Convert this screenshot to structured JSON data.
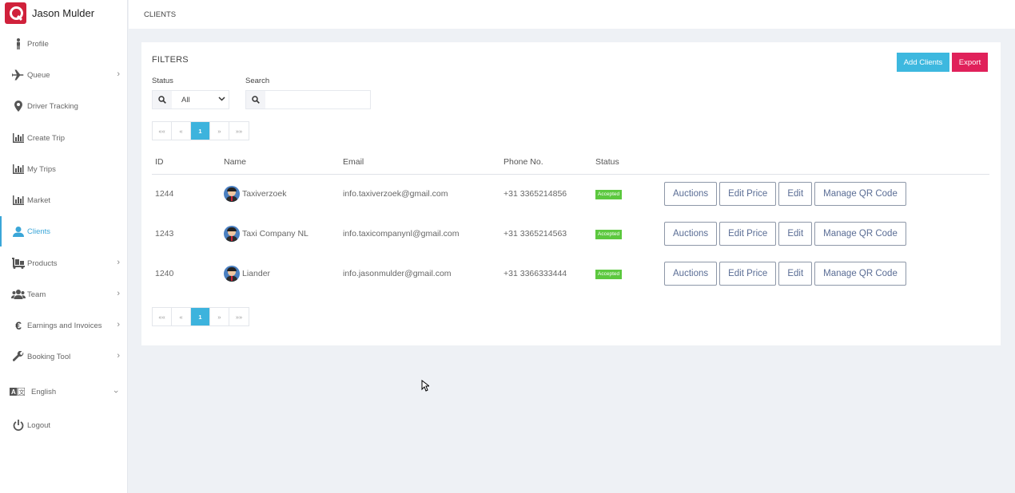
{
  "brand": {
    "name": "Jason Mulder",
    "logo": "q-logo"
  },
  "sidebar": {
    "items": [
      {
        "label": "Profile",
        "icon": "person-icon",
        "chevron": false,
        "active": false
      },
      {
        "label": "Queue",
        "icon": "plane-icon",
        "chevron": true,
        "active": false
      },
      {
        "label": "Driver Tracking",
        "icon": "map-pin-icon",
        "chevron": false,
        "active": false
      },
      {
        "label": "Create Trip",
        "icon": "bar-chart-icon",
        "chevron": false,
        "active": false
      },
      {
        "label": "My Trips",
        "icon": "bar-chart-icon",
        "chevron": false,
        "active": false
      },
      {
        "label": "Market",
        "icon": "bar-chart-icon",
        "chevron": false,
        "active": false
      },
      {
        "label": "Clients",
        "icon": "user-icon",
        "chevron": false,
        "active": true
      },
      {
        "label": "Products",
        "icon": "dolly-icon",
        "chevron": true,
        "active": false
      },
      {
        "label": "Team",
        "icon": "users-icon",
        "chevron": true,
        "active": false
      },
      {
        "label": "Earnings and Invoices",
        "icon": "euro-icon",
        "chevron": true,
        "active": false
      },
      {
        "label": "Booking Tool",
        "icon": "wrench-icon",
        "chevron": true,
        "active": false
      }
    ],
    "language": {
      "label": "English",
      "icon": "language-icon"
    },
    "logout": {
      "label": "Logout",
      "icon": "power-icon"
    }
  },
  "breadcrumb": "CLIENTS",
  "filters": {
    "title": "FILTERS",
    "status_label": "Status",
    "status_value": "All",
    "search_label": "Search",
    "search_value": ""
  },
  "buttons": {
    "add": "Add Clients",
    "export": "Export"
  },
  "pagination": {
    "first": "««",
    "prev": "«",
    "current": "1",
    "next": "»",
    "last": "»»"
  },
  "table": {
    "columns": [
      "ID",
      "Name",
      "Email",
      "Phone No.",
      "Status"
    ],
    "rows": [
      {
        "id": "1244",
        "name": "Taxiverzoek",
        "email": "info.taxiverzoek@gmail.com",
        "phone": "+31 3365214856",
        "status": "Accepted"
      },
      {
        "id": "1243",
        "name": "Taxi Company NL",
        "email": "info.taxicompanynl@gmail.com",
        "phone": "+31 3365214563",
        "status": "Accepted"
      },
      {
        "id": "1240",
        "name": "Liander",
        "email": "info.jasonmulder@gmail.com",
        "phone": "+31 3366333444",
        "status": "Accepted"
      }
    ],
    "actions": [
      "Auctions",
      "Edit Price",
      "Edit",
      "Manage QR Code"
    ]
  },
  "colors": {
    "accent": "#3db8df",
    "danger": "#e0215a",
    "success": "#5cc83f",
    "brand": "#d0213b"
  }
}
